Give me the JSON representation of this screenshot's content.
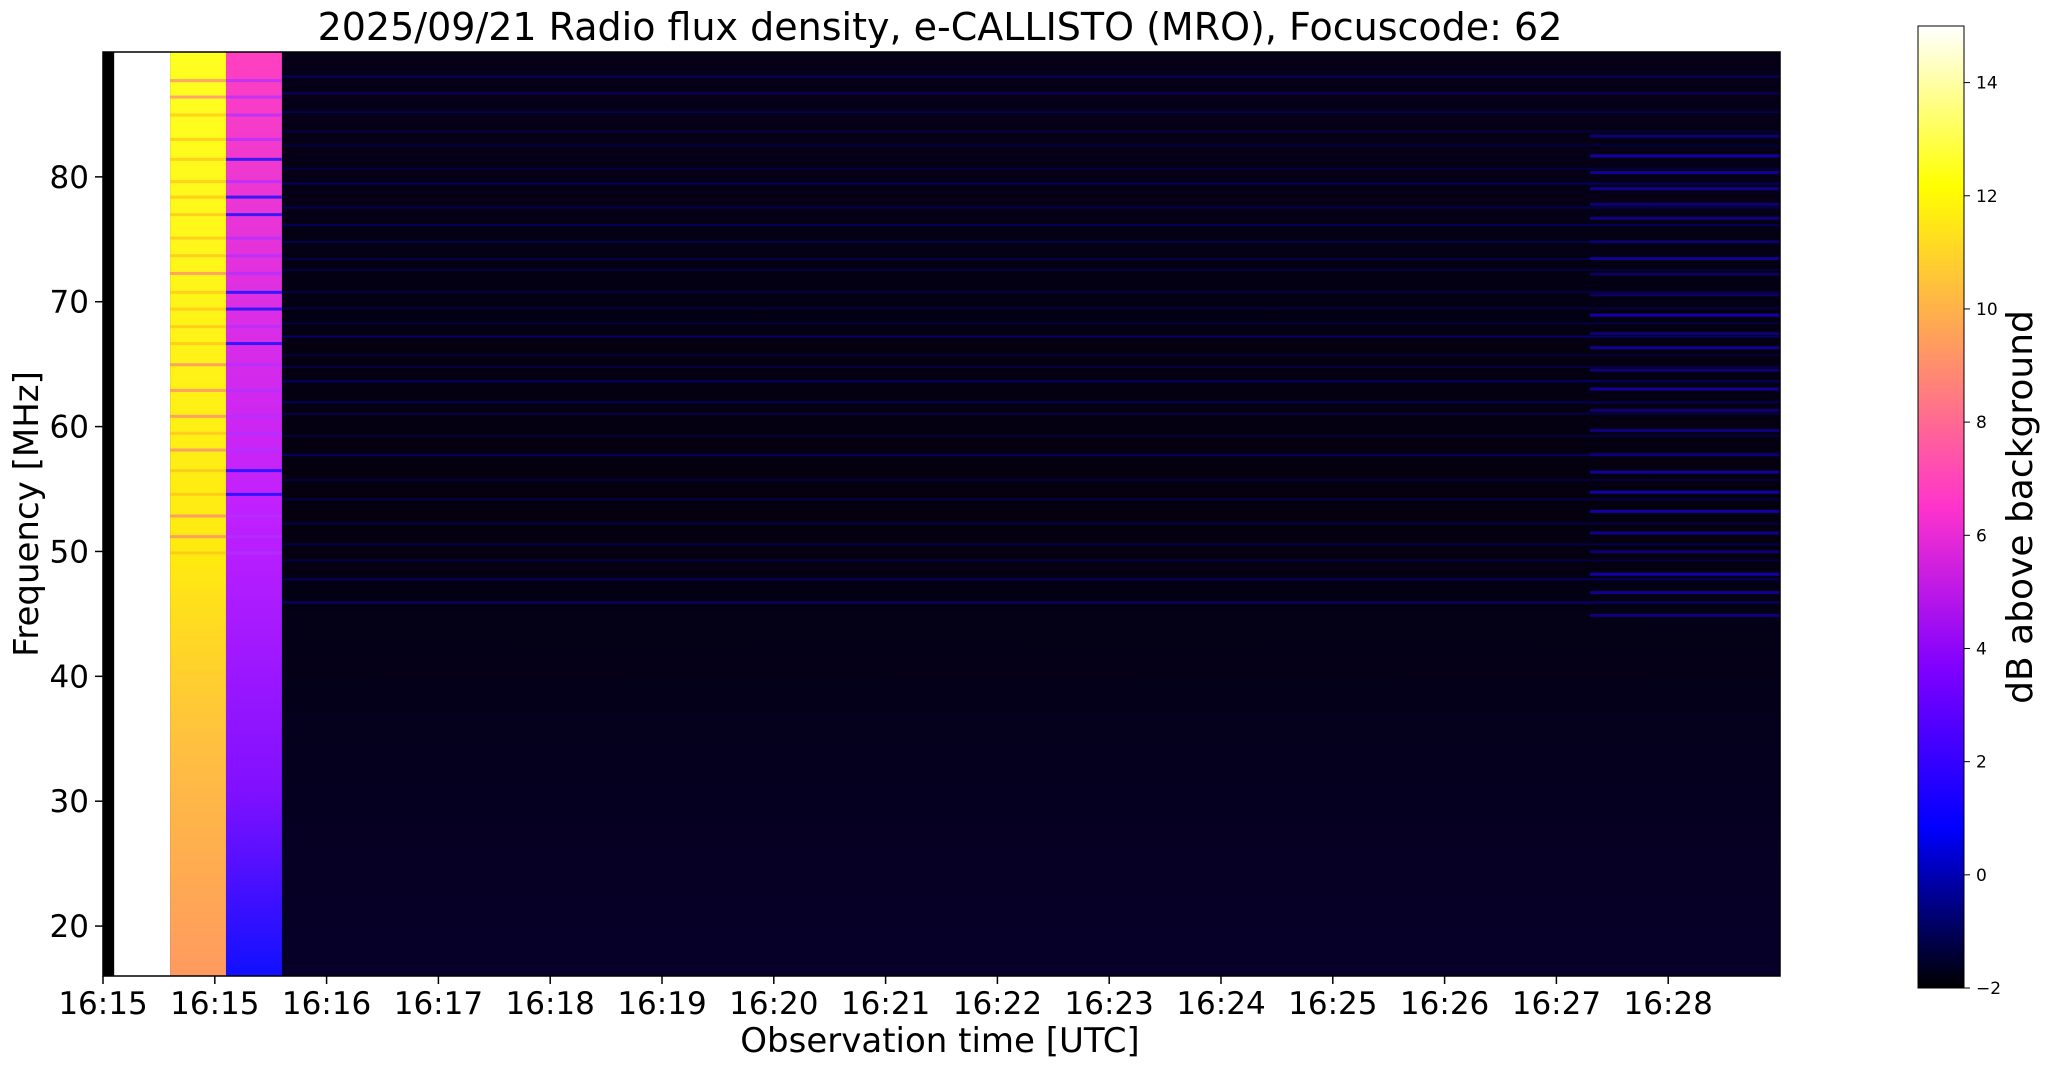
{
  "chart_data": {
    "type": "heatmap",
    "title": "2025/09/21  Radio flux density, e-CALLISTO (MRO), Focuscode: 62",
    "xlabel": "Observation time [UTC]",
    "ylabel": "Frequency [MHz]",
    "x_tick_labels": [
      "16:15",
      "16:15",
      "16:16",
      "16:17",
      "16:18",
      "16:19",
      "16:20",
      "16:21",
      "16:22",
      "16:23",
      "16:24",
      "16:25",
      "16:26",
      "16:27",
      "16:28"
    ],
    "x_ticks_minutes": [
      0.0,
      1.0,
      2.0,
      3.0,
      4.0,
      5.0,
      6.0,
      7.0,
      8.0,
      9.0,
      10.0,
      11.0,
      12.0,
      13.0,
      14.0
    ],
    "xlim_minutes": [
      0.0,
      15.0
    ],
    "y_ticks": [
      20,
      30,
      40,
      50,
      60,
      70,
      80
    ],
    "ylim": [
      16,
      90
    ],
    "colorbar": {
      "label": "dB above background",
      "ticks": [
        -2,
        0,
        2,
        4,
        6,
        8,
        10,
        12,
        14
      ],
      "range": [
        -2,
        15
      ],
      "colormap": "gnuplot2",
      "colors": [
        "#000000",
        "#0000ff",
        "#8000ff",
        "#ff33cc",
        "#ff9a60",
        "#ffff00",
        "#ffffff"
      ]
    },
    "segments": [
      {
        "t": [
          0.0,
          0.1
        ],
        "db": -2,
        "note": "dark edge"
      },
      {
        "t": [
          0.1,
          0.6
        ],
        "db": 15
      },
      {
        "t": [
          0.6,
          1.1
        ],
        "db_low_freq": 11,
        "db_high_freq": 15
      },
      {
        "t": [
          1.1,
          1.6
        ],
        "db_low_freq": 3,
        "db_high_freq": 8
      },
      {
        "t": [
          1.6,
          15.0
        ],
        "db": -0.5
      }
    ],
    "features": [
      {
        "t": [
          13.3,
          15.0
        ],
        "freq": [
          45,
          85
        ],
        "db": 1.5,
        "description": "horizontal bands"
      }
    ],
    "grid": false
  }
}
